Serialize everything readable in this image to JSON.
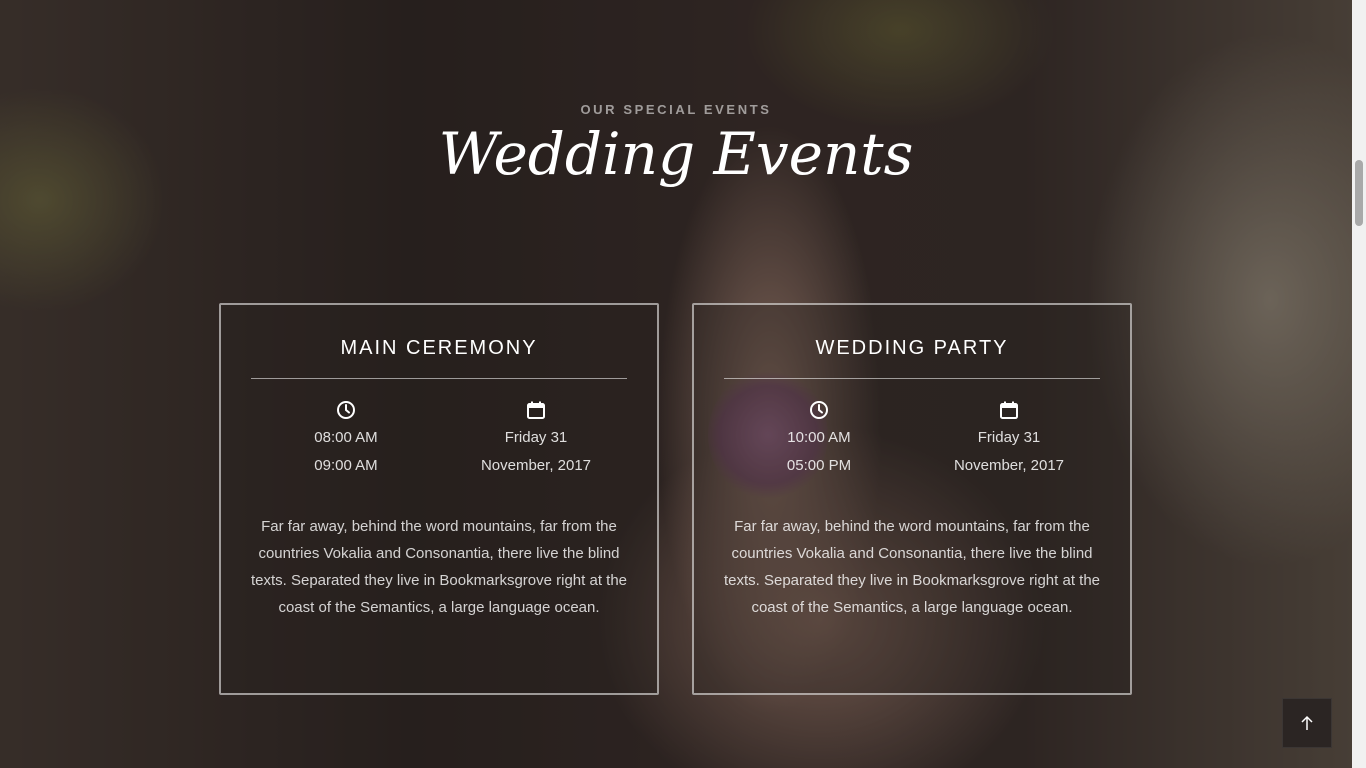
{
  "section": {
    "eyebrow": "OUR SPECIAL EVENTS",
    "title": "Wedding Events"
  },
  "events": [
    {
      "name": "MAIN CEREMONY",
      "time_start": "08:00 AM",
      "time_end": "09:00 AM",
      "date_day": "Friday 31",
      "date_month": "November, 2017",
      "description": "Far far away, behind the word mountains, far from the countries Vokalia and Consonantia, there live the blind texts. Separated they live in Bookmarksgrove right at the coast of the Semantics, a large language ocean.",
      "time_icon": "clock-icon",
      "date_icon": "calendar-icon"
    },
    {
      "name": "WEDDING PARTY",
      "time_start": "10:00 AM",
      "time_end": "05:00 PM",
      "date_day": "Friday 31",
      "date_month": "November, 2017",
      "description": "Far far away, behind the word mountains, far from the countries Vokalia and Consonantia, there live the blind texts. Separated they live in Bookmarksgrove right at the coast of the Semantics, a large language ocean.",
      "time_icon": "clock-icon",
      "date_icon": "calendar-icon"
    }
  ],
  "back_to_top": {
    "icon": "arrow-up-icon"
  },
  "colors": {
    "card_border": "#d9d5d3",
    "text": "#ffffff",
    "button_bg": "#2b2523"
  }
}
